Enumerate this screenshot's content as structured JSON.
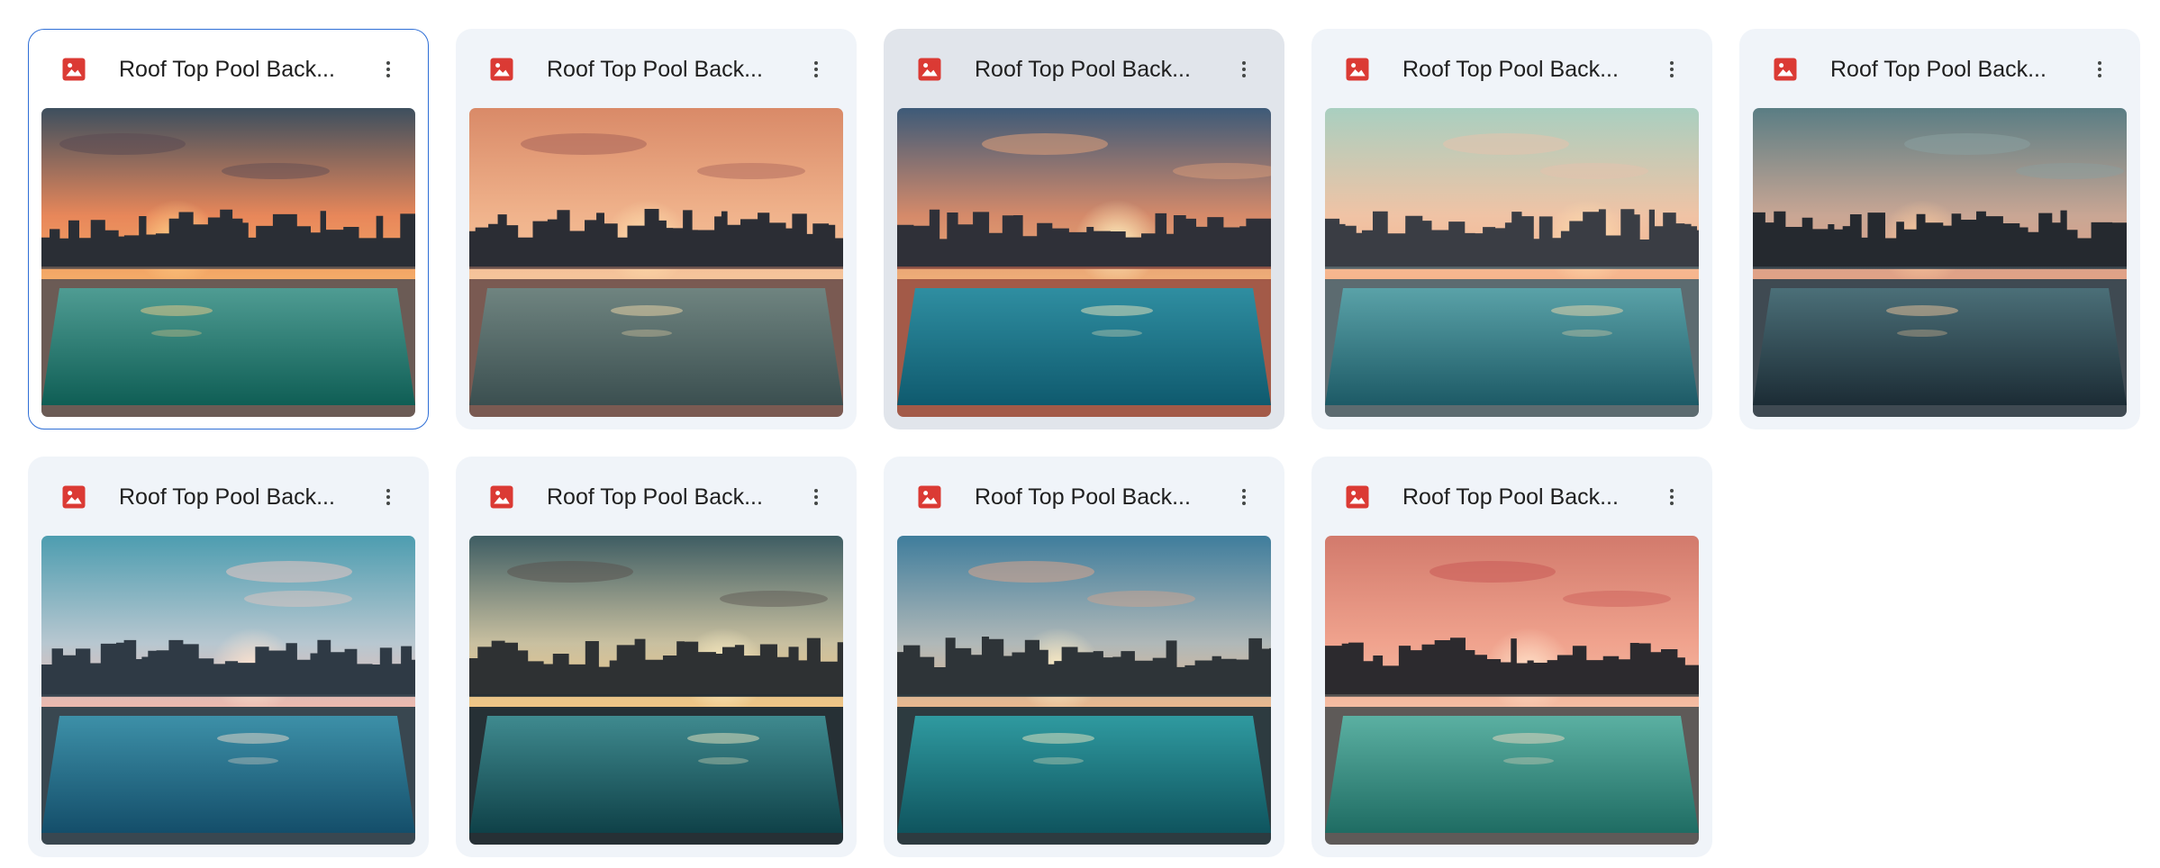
{
  "files": [
    {
      "name": "Roof Top Pool Back...",
      "selected": true,
      "hovered": false,
      "thumbnail": {
        "sky_top": "#3d4f5e",
        "sky_mid": "#e8875a",
        "sky_horizon": "#f6b06a",
        "city": "#2a2e35",
        "sun": "#ffd38a",
        "pool_top": "#4f9c93",
        "pool_bottom": "#0f5e55",
        "deck": "#6b5b55",
        "clouds": "#5b4a52"
      }
    },
    {
      "name": "Roof Top Pool Back...",
      "selected": false,
      "hovered": false,
      "thumbnail": {
        "sky_top": "#d98a68",
        "sky_mid": "#f0b38c",
        "sky_horizon": "#f6c79d",
        "city": "#2b2d34",
        "sun": "#ffe2b0",
        "pool_top": "#6f8480",
        "pool_bottom": "#3b4f50",
        "deck": "#7a5a52",
        "clouds": "#a8645a"
      }
    },
    {
      "name": "Roof Top Pool Back...",
      "selected": false,
      "hovered": true,
      "thumbnail": {
        "sky_top": "#3d5a78",
        "sky_mid": "#d58a6a",
        "sky_horizon": "#f2b27a",
        "city": "#2f3038",
        "sun": "#fff0c0",
        "pool_top": "#2f8ea1",
        "pool_bottom": "#0f5a6e",
        "deck": "#a35a48",
        "clouds": "#e0a07a"
      }
    },
    {
      "name": "Roof Top Pool Back...",
      "selected": false,
      "hovered": false,
      "thumbnail": {
        "sky_top": "#a9cfc0",
        "sky_mid": "#f0c3a5",
        "sky_horizon": "#f7b389",
        "city": "#3a3d44",
        "sun": "#ffe0b0",
        "pool_top": "#5aa2a8",
        "pool_bottom": "#1d5a66",
        "deck": "#5c6b70",
        "clouds": "#e6c2ad"
      }
    },
    {
      "name": "Roof Top Pool Back...",
      "selected": false,
      "hovered": false,
      "thumbnail": {
        "sky_top": "#5a7d84",
        "sky_mid": "#c9a694",
        "sky_horizon": "#e5a184",
        "city": "#25292f",
        "sun": "#ffcfa0",
        "pool_top": "#4b6f78",
        "pool_bottom": "#1c2c35",
        "deck": "#3f4a52",
        "clouds": "#8aa0a0"
      }
    },
    {
      "name": "Roof Top Pool Back...",
      "selected": false,
      "hovered": false,
      "thumbnail": {
        "sky_top": "#4d9db0",
        "sky_mid": "#b8c7d0",
        "sky_horizon": "#f3b7a9",
        "city": "#2f3a45",
        "sun": "#ffe5d0",
        "pool_top": "#3d90a8",
        "pool_bottom": "#144e6a",
        "deck": "#394750",
        "clouds": "#e9c7c2"
      }
    },
    {
      "name": "Roof Top Pool Back...",
      "selected": false,
      "hovered": false,
      "thumbnail": {
        "sky_top": "#3e5d63",
        "sky_mid": "#c9c0a0",
        "sky_horizon": "#f5c681",
        "city": "#2e3133",
        "sun": "#fff2c8",
        "pool_top": "#3f8a8f",
        "pool_bottom": "#0f4148",
        "deck": "#263035",
        "clouds": "#5a5450"
      }
    },
    {
      "name": "Roof Top Pool Back...",
      "selected": false,
      "hovered": false,
      "thumbnail": {
        "sky_top": "#3f7d9c",
        "sky_mid": "#b0b8b8",
        "sky_horizon": "#f0b888",
        "city": "#2e3438",
        "sun": "#fff0c8",
        "pool_top": "#2f9aa0",
        "pool_bottom": "#0f545e",
        "deck": "#2d3b40",
        "clouds": "#d8a48c"
      }
    },
    {
      "name": "Roof Top Pool Back...",
      "selected": false,
      "hovered": false,
      "thumbnail": {
        "sky_top": "#d27a6c",
        "sky_mid": "#f0a38e",
        "sky_horizon": "#f5c0a5",
        "city": "#2c2a2e",
        "sun": "#ffe0c8",
        "pool_top": "#5bb0a2",
        "pool_bottom": "#1f6c63",
        "deck": "#5e5a58",
        "clouds": "#c95a56"
      }
    }
  ]
}
